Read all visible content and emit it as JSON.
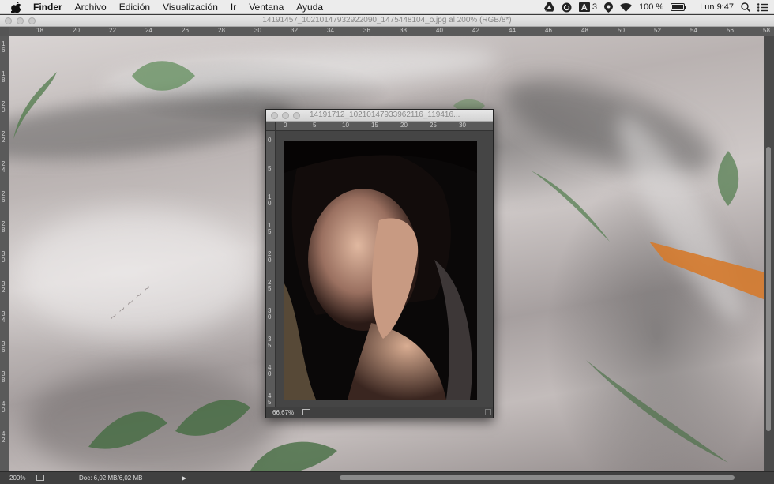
{
  "menubar": {
    "items": [
      "Finder",
      "Archivo",
      "Edición",
      "Visualización",
      "Ir",
      "Ventana",
      "Ayuda"
    ],
    "adobe_badge": "3",
    "battery": "100 %",
    "clock": "Lun 9:47"
  },
  "main_window": {
    "title": "14191457_10210147932922090_1475448104_o.jpg al 200% (RGB/8*)",
    "ruler_h_ticks": [
      "18",
      "20",
      "22",
      "24",
      "26",
      "28",
      "30",
      "32",
      "34",
      "36",
      "38",
      "40",
      "42",
      "44",
      "46",
      "48",
      "50",
      "52",
      "54",
      "56",
      "58"
    ],
    "ruler_v_ticks": [
      "1 6",
      "1 8",
      "2 0",
      "2 2",
      "2 4",
      "2 6",
      "2 8",
      "3 0",
      "3 2",
      "3 4",
      "3 6",
      "3 8",
      "4 0",
      "4 2"
    ],
    "zoom": "200%",
    "doc_info": "Doc: 6,02 MB/6,02 MB"
  },
  "doc_window": {
    "title": "14191712_10210147933962116_119416...",
    "ruler_h_ticks": [
      "0",
      "5",
      "10",
      "15",
      "20",
      "25",
      "30"
    ],
    "ruler_v_ticks": [
      "0",
      "5",
      "1 0",
      "1 5",
      "2 0",
      "2 5",
      "3 0",
      "3 5",
      "4 0",
      "4 5"
    ],
    "zoom": "66,67%"
  },
  "colors": {
    "menubar_bg": "#ececec",
    "app_bg": "#4a4a4a",
    "ruler_bg": "#5a5a5a"
  }
}
